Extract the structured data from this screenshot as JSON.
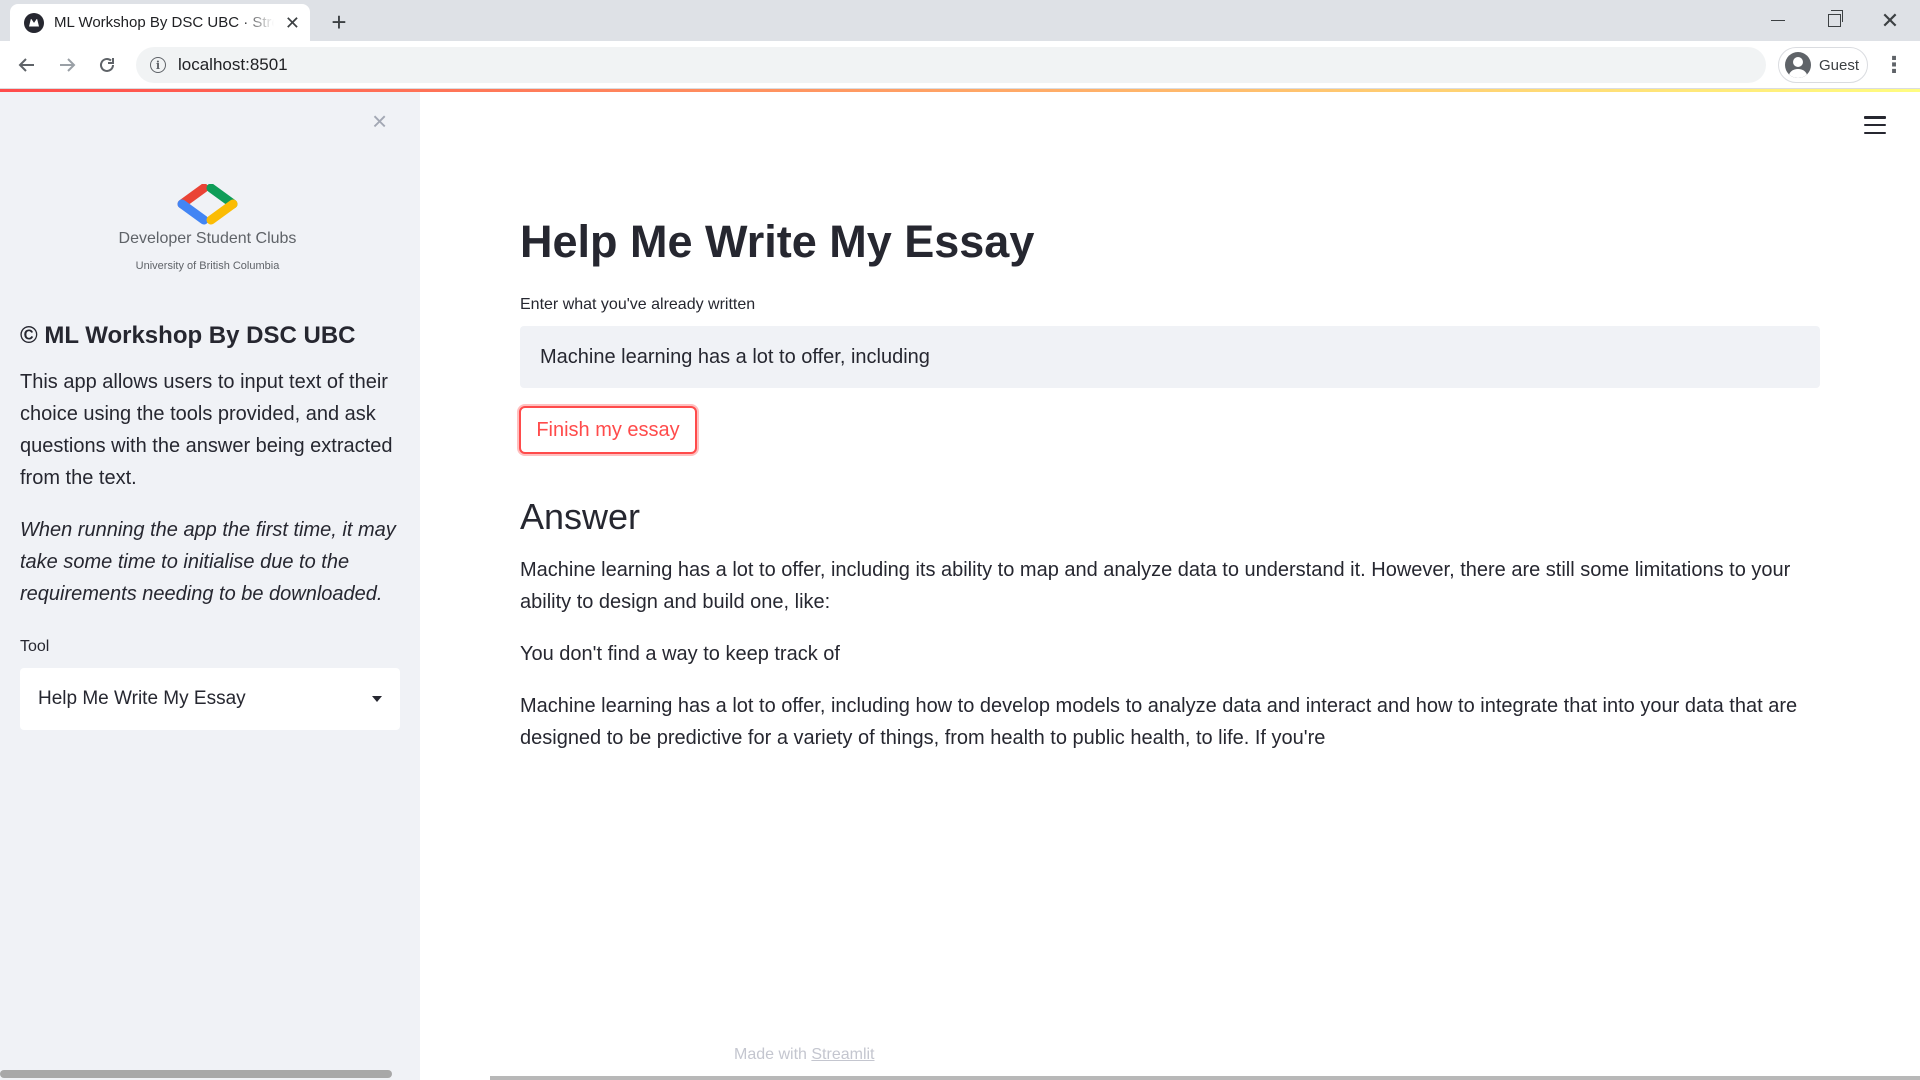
{
  "browser": {
    "tab_title": "ML Workshop By DSC UBC · Streamlit",
    "tab_close": "✕",
    "new_tab": "+",
    "close_window": "✕",
    "url": "localhost:8501",
    "profile_label": "Guest",
    "menu": "⋮"
  },
  "sidebar": {
    "close": "×",
    "logo_text": "Developer Student Clubs",
    "logo_sub": "University of British Columbia",
    "logo_colors": [
      "#ea4335",
      "#4285f4",
      "#0f9d58",
      "#fbbc04"
    ],
    "title": "© ML Workshop By DSC UBC",
    "description": "This app allows users to input text of their choice using the tools provided, and ask questions with the answer being extracted from the text.",
    "note": "When running the app the first time, it may take some time to initialise due to the requirements needing to be downloaded.",
    "tool_label": "Tool",
    "tool_selected": "Help Me Write My Essay"
  },
  "main": {
    "title": "Help Me Write My Essay",
    "input_label": "Enter what you've already written",
    "input_value": "Machine learning has a lot to offer, including",
    "button_label": "Finish my essay",
    "answer_heading": "Answer",
    "paragraphs": [
      "Machine learning has a lot to offer, including its ability to map and analyze data to understand it. However, there are still some limitations to your ability to design and build one, like:",
      "You don't find a way to keep track of",
      "Machine learning has a lot to offer, including how to develop models to analyze data and interact and how to integrate that into your data that are designed to be predictive for a variety of things, from health to public health, to life. If you're"
    ],
    "footer_prefix": "Made with",
    "footer_link": "Streamlit"
  },
  "colors": {
    "primary": "#ff4b4b",
    "sidebar_bg": "#f0f2f6",
    "text": "#262730"
  }
}
